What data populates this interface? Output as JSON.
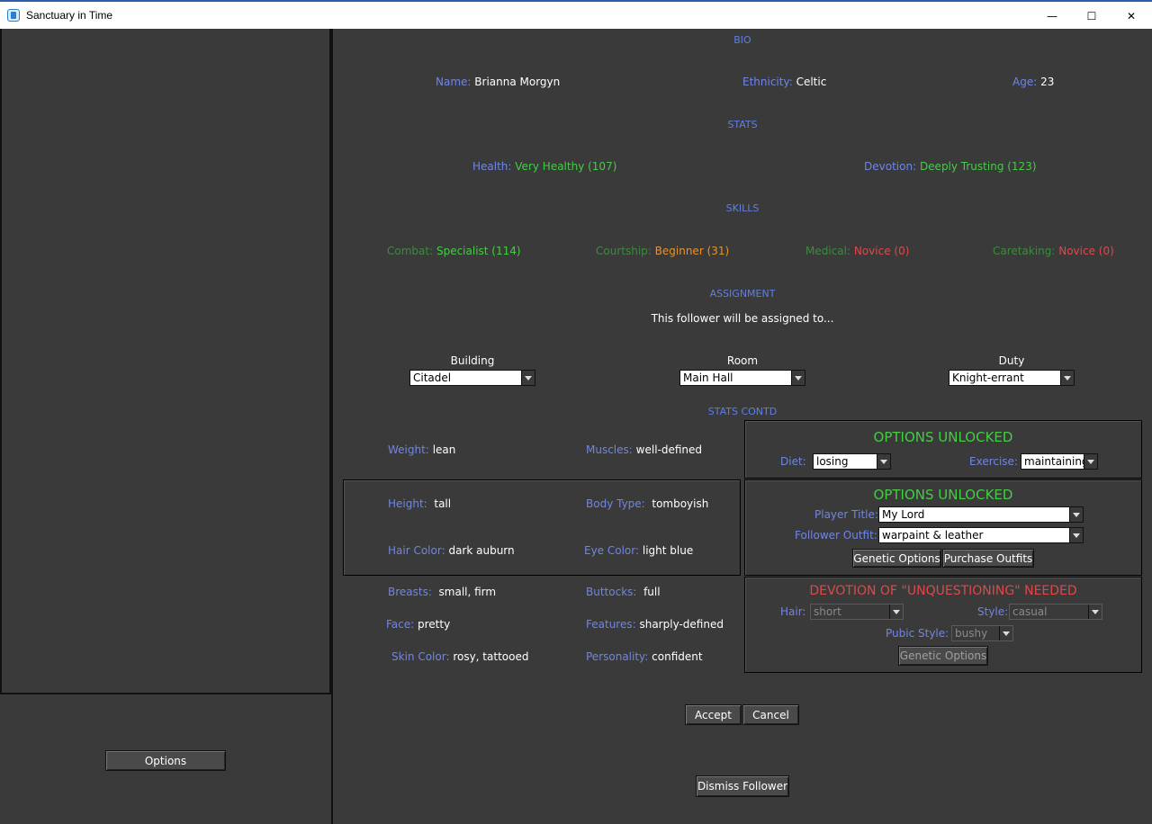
{
  "window": {
    "title": "Sanctuary in Time",
    "minimize": "—",
    "maximize": "☐",
    "close": "✕"
  },
  "left": {
    "options_label": "Options"
  },
  "bio": {
    "header": "BIO",
    "name_label": "Name:",
    "name": "Brianna Morgyn",
    "ethnicity_label": "Ethnicity:",
    "ethnicity": "Celtic",
    "age_label": "Age:",
    "age": "23"
  },
  "stats": {
    "header": "STATS",
    "health_label": "Health:",
    "health": "Very Healthy (107)",
    "devotion_label": "Devotion:",
    "devotion": "Deeply Trusting (123)"
  },
  "skills": {
    "header": "SKILLS",
    "combat_label": "Combat:",
    "combat": "Specialist (114)",
    "courtship_label": "Courtship:",
    "courtship": "Beginner (31)",
    "medical_label": "Medical:",
    "medical": "Novice (0)",
    "caretaking_label": "Caretaking:",
    "caretaking": "Novice (0)"
  },
  "assignment": {
    "header": "ASSIGNMENT",
    "intro": "This follower will be assigned to...",
    "building_label": "Building",
    "building": "Citadel",
    "room_label": "Room",
    "room": "Main Hall",
    "duty_label": "Duty",
    "duty": "Knight-errant"
  },
  "stats_contd": {
    "header": "STATS CONTD",
    "weight_label": "Weight:",
    "weight": "lean",
    "muscles_label": "Muscles:",
    "muscles": "well-defined",
    "height_label": "Height:",
    "height": "tall",
    "bodytype_label": "Body Type:",
    "bodytype": "tomboyish",
    "haircolor_label": "Hair Color:",
    "haircolor": "dark auburn",
    "eyecolor_label": "Eye Color:",
    "eyecolor": "light blue",
    "breasts_label": "Breasts:",
    "breasts": "small, firm",
    "buttocks_label": "Buttocks:",
    "buttocks": "full",
    "face_label": "Face:",
    "face": "pretty",
    "features_label": "Features:",
    "features": "sharply-defined",
    "skincolor_label": "Skin Color:",
    "skincolor": "rosy, tattooed",
    "personality_label": "Personality:",
    "personality": "confident"
  },
  "panel1": {
    "header": "OPTIONS UNLOCKED",
    "diet_label": "Diet:",
    "diet": "losing",
    "exercise_label": "Exercise:",
    "exercise": "maintaining"
  },
  "panel2": {
    "header": "OPTIONS UNLOCKED",
    "player_title_label": "Player Title:",
    "player_title": "My Lord",
    "outfit_label": "Follower Outfit:",
    "outfit": "warpaint & leather",
    "genetic_btn": "Genetic Options",
    "purchase_btn": "Purchase Outfits"
  },
  "panel3": {
    "header": "DEVOTION OF \"UNQUESTIONING\" NEEDED",
    "hair_label": "Hair:",
    "hair": "short",
    "style_label": "Style:",
    "style": "casual",
    "pubic_label": "Pubic Style:",
    "pubic": "bushy",
    "genetic_btn": "Genetic Options"
  },
  "actions": {
    "accept": "Accept",
    "cancel": "Cancel",
    "dismiss": "Dismiss Follower"
  },
  "colors": {
    "background": "#3a3a3a",
    "label": "#6f86e6",
    "good": "#44cc44",
    "warn": "#e8932a",
    "bad": "#e04848"
  }
}
